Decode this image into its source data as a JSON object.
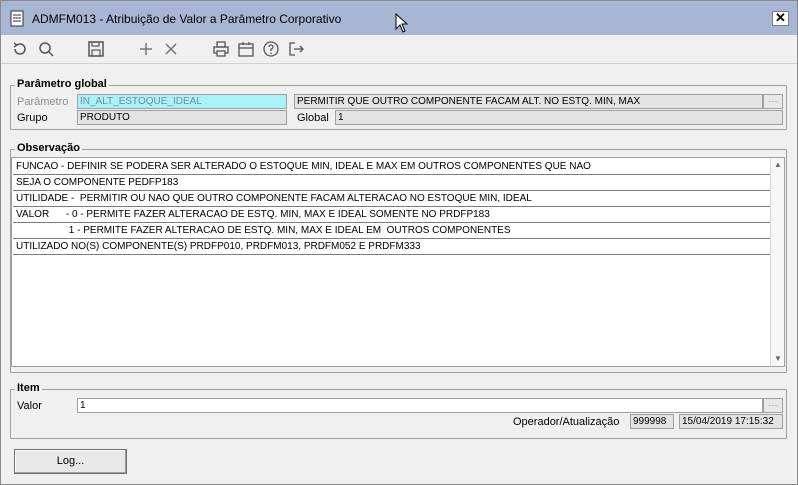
{
  "window": {
    "title": "ADMFM013 - Atribuição de Valor a Parâmetro Corporativo",
    "close_label": "✕"
  },
  "toolbar": {
    "icons": [
      "refresh-icon",
      "search-icon",
      "save-icon",
      "add-icon",
      "delete-icon",
      "print-icon",
      "calendar-icon",
      "help-icon",
      "exit-icon"
    ]
  },
  "parametro_global": {
    "title": "Parâmetro global",
    "parametro_label": "Parâmetro",
    "parametro_value": "IN_ALT_ESTOQUE_IDEAL",
    "descricao_value": "PERMITIR QUE OUTRO COMPONENTE FACAM ALT. NO ESTQ. MIN, MAX",
    "grupo_label": "Grupo",
    "grupo_value": "PRODUTO",
    "global_label": "Global",
    "global_value": "1"
  },
  "observacao": {
    "title": "Observação",
    "lines": [
      "FUNCAO - DEFINIR SE PODERA SER ALTERADO O ESTOQUE MIN, IDEAL E MAX EM OUTROS COMPONENTES QUE NAO",
      "SEJA O COMPONENTE PEDFP183",
      "UTILIDADE -  PERMITIR OU NAO QUE OUTRO COMPONENTE FACAM ALTERACAO NO ESTOQUE MIN, IDEAL",
      "VALOR      - 0 - PERMITE FAZER ALTERACAO DE ESTQ. MIN, MAX E IDEAL SOMENTE NO PRDFP183",
      "                   1 - PERMITE FAZER ALTERACAO DE ESTQ. MIN, MAX E IDEAL EM  OUTROS COMPONENTES",
      "UTILIZADO NO(S) COMPONENTE(S) PRDFP010, PRDFM013, PRDFM052 E PRDFM333"
    ]
  },
  "item": {
    "title": "Item",
    "valor_label": "Valor",
    "valor_value": "1",
    "operador_label": "Operador/Atualização",
    "operador_value": "999998",
    "data_value": "15/04/2019 17:15:32"
  },
  "footer": {
    "log_label": "Log..."
  }
}
